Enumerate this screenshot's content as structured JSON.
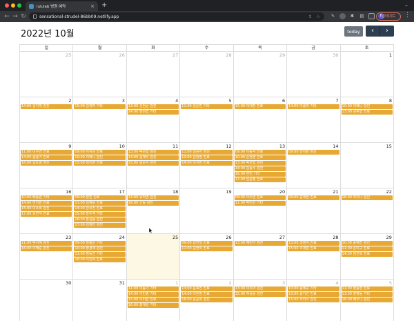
{
  "browser": {
    "tab_title": "lululab 병원 예약",
    "tab_close": "×",
    "new_tab": "+",
    "tab_menu": "⌄",
    "url": "sensational-strudel-86bb09.netlify.app",
    "profile_label": "업데이트",
    "colors": {
      "red": "#ff5f57",
      "yellow": "#febc2e",
      "green": "#28c840"
    }
  },
  "calendar": {
    "title": "2022년 10월",
    "today_label": "today",
    "prev_label": "‹",
    "next_label": "›",
    "weekdays": [
      "일",
      "월",
      "화",
      "수",
      "목",
      "금",
      "토"
    ],
    "event_color": "#e8a934",
    "today_bg": "#fcf8e3",
    "weeks": [
      [
        {
          "n": "25",
          "other": true,
          "events": []
        },
        {
          "n": "26",
          "other": true,
          "events": []
        },
        {
          "n": "27",
          "other": true,
          "events": []
        },
        {
          "n": "28",
          "other": true,
          "events": []
        },
        {
          "n": "29",
          "other": true,
          "events": []
        },
        {
          "n": "30",
          "other": true,
          "events": []
        },
        {
          "n": "1",
          "events": []
        }
      ],
      [
        {
          "n": "2",
          "events": [
            "14:00 김지혁 검진"
          ]
        },
        {
          "n": "3",
          "events": [
            "15:00 김계자 기타"
          ]
        },
        {
          "n": "4",
          "events": [
            "13:00 신현균 검진",
            "14:00 장원형 기타"
          ]
        },
        {
          "n": "5",
          "events": [
            "11:00 김윤진 기타"
          ]
        },
        {
          "n": "6",
          "events": [
            "15:00 이대환 진료"
          ]
        },
        {
          "n": "7",
          "events": [
            "14:00 이종미 기타"
          ]
        },
        {
          "n": "8",
          "events": [
            "10:00 이해니 검진",
            "13:00 김휘형 진료"
          ]
        }
      ],
      [
        {
          "n": "9",
          "events": [
            "11:00 이수연 진료",
            "14:00 송종기 진료",
            "16:00 남도렬 검진"
          ]
        },
        {
          "n": "10",
          "events": [
            "09:00 이지은 진료",
            "10:00 지해니 검진",
            "15:00 엄지훈 진료"
          ]
        },
        {
          "n": "11",
          "events": [
            "13:00 박은형 검진",
            "14:00 김재우 검진",
            "15:00 김준수 검진"
          ]
        },
        {
          "n": "12",
          "events": [
            "11:00 임윤아 검진",
            "13:00 김현정 진료",
            "14:00 이서현 진료"
          ]
        },
        {
          "n": "13",
          "events": [
            "09:00 이동석 진료",
            "10:00 손현영 진료",
            "13:00 박은형 검진",
            "14:00 김동수 검진",
            "16:00 한민 기타",
            "17:00 임윤정 진료"
          ]
        },
        {
          "n": "14",
          "events": [
            "09:00 전지현 검진"
          ]
        },
        {
          "n": "15",
          "events": []
        }
      ],
      [
        {
          "n": "16",
          "events": [
            "10:00 배송관 기타",
            "14:00 허지원 진료",
            "15:00 이소희 검진",
            "17:00 유연석 진료"
          ]
        },
        {
          "n": "17",
          "events": [
            "09:00 한빈 진료",
            "11:00 김재윤 진료",
            "14:00 안유진 진료",
            "15:00 장수석 기타",
            "16:00 홍길동 검진",
            "17:00 김정민 검진"
          ]
        },
        {
          "n": "18",
          "events": [
            "13:00 유아연 검진",
            "16:00 신동 검진"
          ]
        },
        {
          "n": "19",
          "events": []
        },
        {
          "n": "20",
          "events": [
            "09:00 이수연 진료",
            "11:00 박민빈 기타"
          ]
        },
        {
          "n": "21",
          "events": [
            "09:00 김재현 진료"
          ]
        },
        {
          "n": "22",
          "events": [
            "16:00 허지나 검진"
          ]
        }
      ],
      [
        {
          "n": "23",
          "events": [
            "11:00 박서혜 검진",
            "16:00 이해준 검진"
          ]
        },
        {
          "n": "24",
          "events": [
            "09:00 정흥준 기타",
            "10:00 정경재 검진",
            "13:00 정동건 기타",
            "16:00 이진희 진료"
          ]
        },
        {
          "n": "25",
          "today": true,
          "events": []
        },
        {
          "n": "26",
          "events": [
            "09:00 김연일 진료",
            "11:00 김현희 진료"
          ]
        },
        {
          "n": "27",
          "events": [
            "13:00 채민아 검진"
          ]
        },
        {
          "n": "28",
          "events": [
            "13:00 조정석 진료",
            "15:00 조재훈 진료"
          ]
        },
        {
          "n": "29",
          "events": [
            "10:00 송해진 검진",
            "11:00 손미구 진료",
            "14:00 김진모 진료"
          ]
        }
      ],
      [
        {
          "n": "30",
          "events": []
        },
        {
          "n": "31",
          "events": []
        },
        {
          "n": "1",
          "other": true,
          "events": [
            "11:00 이동기 기타",
            "14:00 이민영 기타",
            "15:00 이미란 진료",
            "16:00 홍계성 기타"
          ]
        },
        {
          "n": "2",
          "other": true,
          "events": [
            "13:00 윤효진 진료",
            "14:00 이민정 진료",
            "16:00 윤윤희 검진"
          ]
        },
        {
          "n": "3",
          "other": true,
          "events": [
            "13:00 이지아 검진",
            "15:00 차승용 검진"
          ]
        },
        {
          "n": "4",
          "other": true,
          "events": [
            "10:00 송혜교 기타",
            "13:00 송가인 진료",
            "15:00 하리사 검진"
          ]
        },
        {
          "n": "5",
          "other": true,
          "events": [
            "11:00 정동환 진료",
            "13:00 양영동 기타",
            "16:00 배우나 검진"
          ]
        }
      ]
    ]
  }
}
